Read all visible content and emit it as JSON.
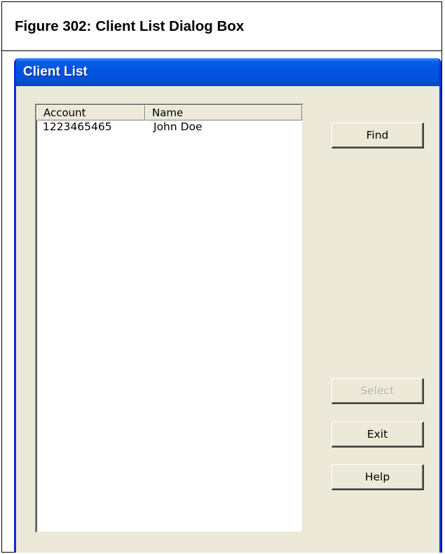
{
  "figure": {
    "number": "Figure 302:",
    "title": "Client List Dialog Box"
  },
  "dialog": {
    "title": "Client List",
    "list": {
      "columns": [
        "Account",
        "Name"
      ],
      "rows": [
        {
          "account": "1223465465",
          "name": "John Doe"
        }
      ]
    },
    "buttons": {
      "find": "Find",
      "select": "Select",
      "exit": "Exit",
      "help": "Help"
    },
    "select_enabled": false
  },
  "colors": {
    "titlebar": "#0054e3",
    "dialog_bg": "#ece9d8",
    "disabled_text": "#b0ad9e"
  }
}
